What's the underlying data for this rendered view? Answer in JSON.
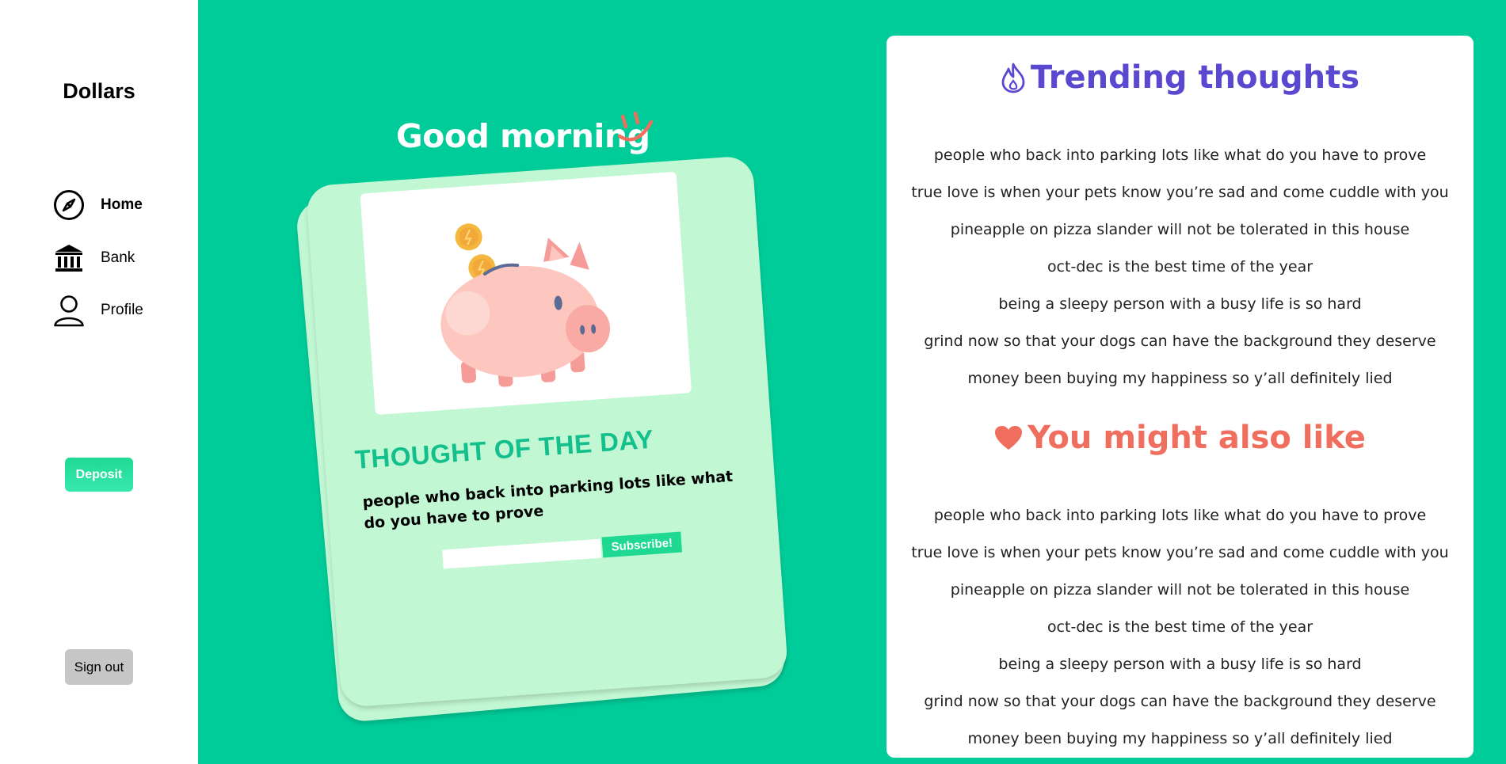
{
  "sidebar": {
    "brand": "Dollars",
    "nav": [
      {
        "label": "Home",
        "icon": "compass-icon",
        "active": true
      },
      {
        "label": "Bank",
        "icon": "bank-icon",
        "active": false
      },
      {
        "label": "Profile",
        "icon": "person-icon",
        "active": false
      }
    ],
    "deposit_label": "Deposit",
    "signout_label": "Sign out"
  },
  "main": {
    "greeting": "Good morning",
    "card": {
      "heading": "THOUGHT OF THE DAY",
      "thought": "people who back into parking lots like what do you have to prove",
      "subscribe_placeholder": "",
      "subscribe_label": "Subscribe!",
      "image": "piggy-bank-illustration"
    }
  },
  "trending": {
    "title": "Trending thoughts",
    "icon": "flame-icon",
    "items": [
      "people who back into parking lots like what do you have to prove",
      "true love is when your pets know you’re sad and come cuddle with you",
      "pineapple on pizza slander will not be tolerated in this house",
      "oct-dec is the best time of the year",
      "being a sleepy person with a busy life is so hard",
      "grind now so that your dogs can have the background they deserve",
      "money been buying my happiness so y’all definitely lied"
    ]
  },
  "also_like": {
    "title": "You might also like",
    "icon": "heart-icon",
    "items": [
      "people who back into parking lots like what do you have to prove",
      "true love is when your pets know you’re sad and come cuddle with you",
      "pineapple on pizza slander will not be tolerated in this house",
      "oct-dec is the best time of the year",
      "being a sleepy person with a busy life is so hard",
      "grind now so that your dogs can have the background they deserve",
      "money been buying my happiness so y’all definitely lied"
    ]
  },
  "colors": {
    "background": "#00cc99",
    "card": "#c2f7d4",
    "accent_green": "#13c08c",
    "trending_purple": "#5b48d0",
    "also_like_coral": "#f06e5e"
  }
}
